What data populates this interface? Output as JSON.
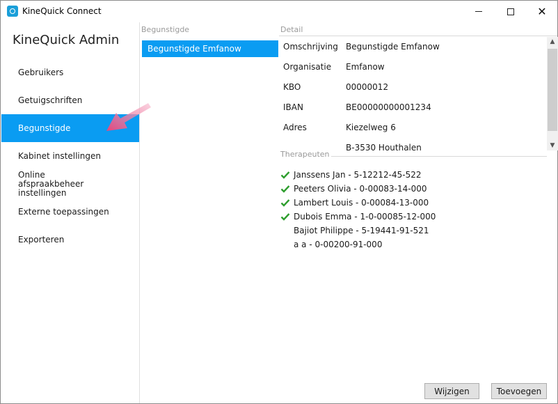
{
  "window": {
    "title": "KineQuick Connect"
  },
  "sidebar": {
    "title": "KineQuick Admin",
    "items": [
      {
        "label": "Gebruikers"
      },
      {
        "label": "Getuigschriften"
      },
      {
        "label": "Begunstigde"
      },
      {
        "label": "Kabinet instellingen"
      },
      {
        "label": "Online afspraakbeheer instellingen"
      },
      {
        "label": "Externe toepassingen"
      },
      {
        "label": "Exporteren"
      }
    ],
    "active_index": 2
  },
  "beneficiaries": {
    "header": "Begunstigde",
    "items": [
      {
        "label": "Begunstigde Emfanow"
      }
    ]
  },
  "detail": {
    "header": "Detail",
    "rows": [
      {
        "label": "Omschrijving",
        "value": "Begunstigde Emfanow"
      },
      {
        "label": "Organisatie",
        "value": "Emfanow"
      },
      {
        "label": "KBO",
        "value": "00000012"
      },
      {
        "label": "IBAN",
        "value": "BE00000000001234"
      },
      {
        "label": "Adres",
        "value": "Kiezelweg 6"
      },
      {
        "label": "",
        "value": "B-3530 Houthalen"
      }
    ]
  },
  "therapists": {
    "header": "Therapeuten",
    "items": [
      {
        "label": "Janssens Jan - 5-12212-45-522",
        "checked": true
      },
      {
        "label": "Peeters Olivia - 0-00083-14-000",
        "checked": true
      },
      {
        "label": "Lambert Louis - 0-00084-13-000",
        "checked": true
      },
      {
        "label": "Dubois Emma - 1-0-00085-12-000",
        "checked": true
      },
      {
        "label": "Bajiot Philippe - 5-19441-91-521",
        "checked": false
      },
      {
        "label": "a a - 0-00200-91-000",
        "checked": false
      }
    ]
  },
  "actions": {
    "edit_label": "Wijzigen",
    "add_label": "Toevoegen"
  },
  "colors": {
    "accent": "#0a9cf2",
    "check": "#2e9e2e",
    "annotation_arrow": "#e8457a"
  },
  "icons": {
    "app": "kinequick-app-icon",
    "minimize": "minimize-icon",
    "maximize": "maximize-icon",
    "close": "close-icon",
    "check": "check-icon",
    "annotation": "arrow-pointer-icon"
  }
}
